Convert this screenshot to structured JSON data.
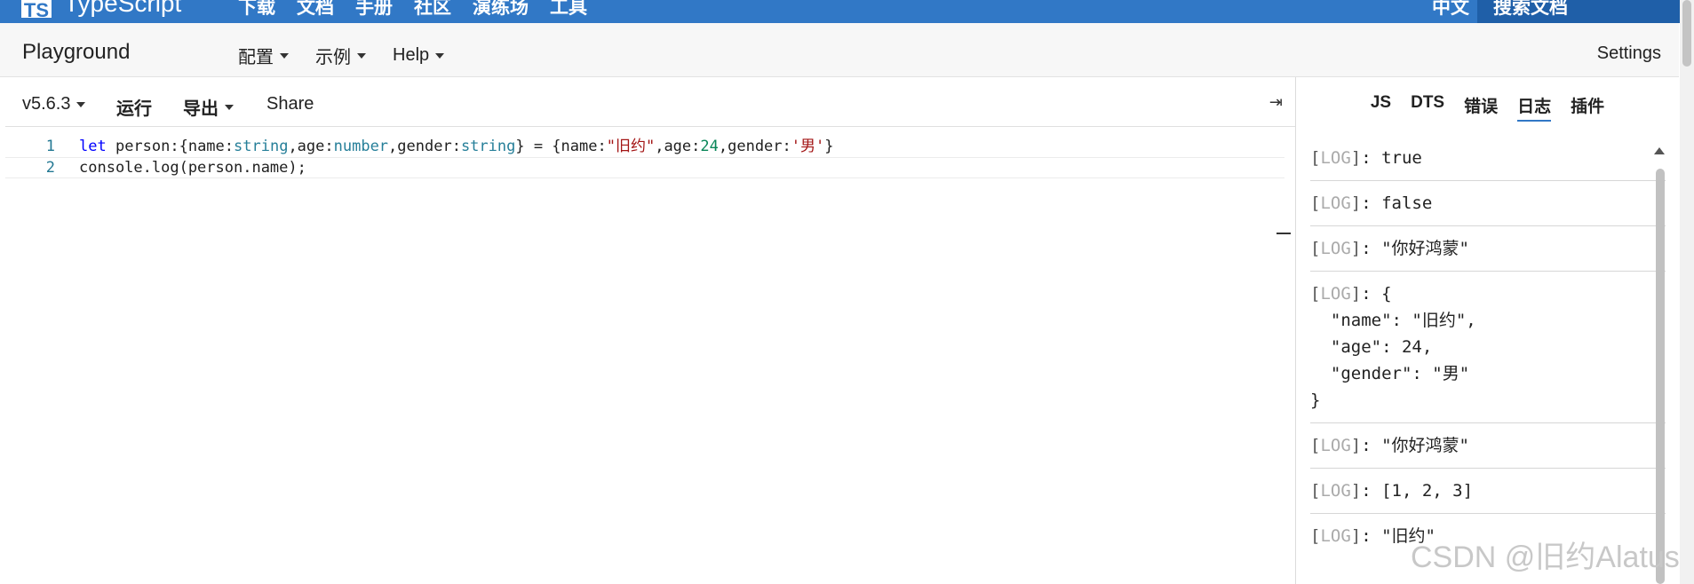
{
  "topnav": {
    "logo_text": "TS",
    "brand": "TypeScript",
    "links": [
      "下载",
      "文档",
      "手册",
      "社区",
      "演练场",
      "工具"
    ],
    "language": "中文",
    "search_label": "搜索文档",
    "bg_color": "#3178c6"
  },
  "header": {
    "title": "Playground",
    "menu": [
      "配置",
      "示例",
      "Help"
    ],
    "settings": "Settings"
  },
  "toolbar": {
    "version": "v5.6.3",
    "run": "运行",
    "export": "导出",
    "share": "Share",
    "collapse_icon": "⇥"
  },
  "editor": {
    "line_numbers": [
      "1",
      "2"
    ],
    "lines": [
      "let person:{name:string,age:number,gender:string} = {name:\"旧约\",age:24,gender:'男'}",
      "console.log(person.name);"
    ]
  },
  "output": {
    "tabs": [
      "JS",
      "DTS",
      "错误",
      "日志",
      "插件"
    ],
    "active_tab": "日志",
    "log_tag": "LOG",
    "logs": [
      ": true",
      ": false",
      ": \"你好鸿蒙\"",
      ": {\n  \"name\": \"旧约\",\n  \"age\": 24,\n  \"gender\": \"男\"\n}",
      ": \"你好鸿蒙\"",
      ": [1, 2, 3]",
      ": \"旧约\""
    ]
  },
  "watermark": "CSDN @旧约Alatus"
}
